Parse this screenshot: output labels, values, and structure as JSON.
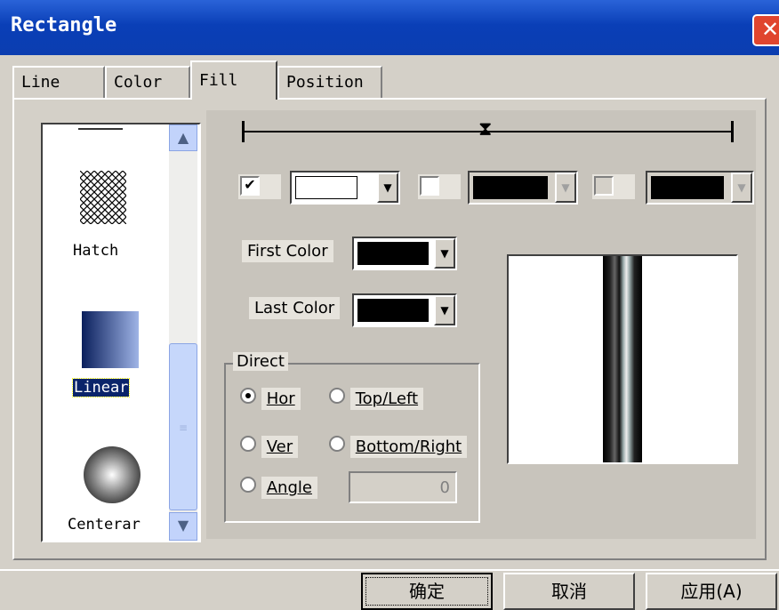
{
  "window": {
    "title": "Rectangle",
    "close_glyph": "✕"
  },
  "tabs": [
    {
      "label": "Line"
    },
    {
      "label": "Color"
    },
    {
      "label": "Fill"
    },
    {
      "label": "Position"
    }
  ],
  "fill_list": {
    "items": [
      {
        "label": "Hatch",
        "icon": "hatch-icon"
      },
      {
        "label": "Linear",
        "icon": "linear-gradient-icon",
        "selected": true
      },
      {
        "label": "Centerar",
        "icon": "radial-gradient-icon"
      }
    ],
    "scroll_up_glyph": "▲",
    "scroll_down_glyph": "▼",
    "thumb_grip": "≡"
  },
  "slider": {
    "handle_glyph": "⧗"
  },
  "color_stops": [
    {
      "checked": true,
      "check_glyph": "✔",
      "color": "#ffffff",
      "enabled": true
    },
    {
      "checked": false,
      "check_glyph": "",
      "color": "#000000",
      "enabled": false
    },
    {
      "checked": false,
      "check_glyph": "",
      "color": "#000000",
      "enabled": false
    }
  ],
  "first_color": {
    "label": "First Color",
    "color": "#000000"
  },
  "last_color": {
    "label": "Last Color",
    "color": "#000000"
  },
  "direct": {
    "legend": "Direct",
    "options": [
      {
        "label": "Hor",
        "checked": true
      },
      {
        "label": "Top/Left",
        "checked": false
      },
      {
        "label": "Ver",
        "checked": false
      },
      {
        "label": "Bottom/Right",
        "checked": false
      },
      {
        "label": "Angle",
        "checked": false
      }
    ],
    "angle_value": "0"
  },
  "buttons": {
    "ok": "确定",
    "cancel": "取消",
    "apply": "应用(A)"
  },
  "colors": {
    "titlebar": "#0a3fb7",
    "dialog": "#d4d0c8",
    "selection": "#0a246a"
  }
}
